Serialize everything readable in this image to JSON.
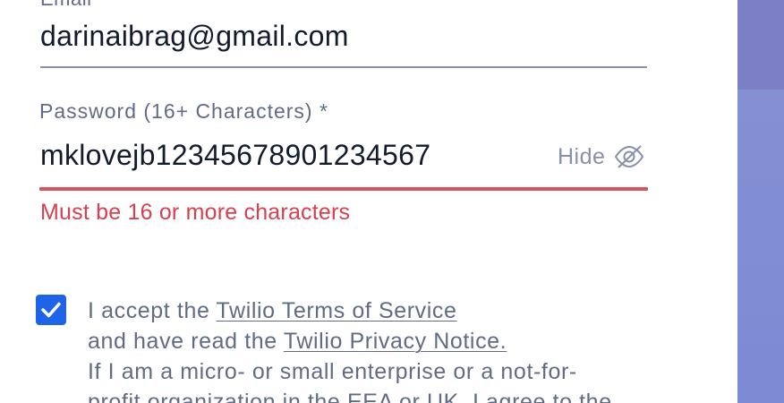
{
  "email": {
    "label": "Email",
    "value": "darinaibrag@gmail.com"
  },
  "password": {
    "label": "Password (16+ Characters) *",
    "value": "mklovejb12345678901234567",
    "toggle_label": "Hide",
    "toggle_icon": "eye-slash-icon",
    "error": "Must be 16 or more characters"
  },
  "terms": {
    "checked": true,
    "line1_prefix": "I accept the ",
    "terms_link": "Twilio Terms of Service",
    "line2_prefix": "and have read the ",
    "privacy_link": "Twilio Privacy Notice.",
    "line3": "If I am a micro- or small enterprise or a not-for-",
    "line4": "profit organization in the EEA or UK, I agree to the"
  },
  "colors": {
    "error": "#d6404f",
    "checkbox": "#1f64e8",
    "side_panel": "#7d8ad4"
  }
}
